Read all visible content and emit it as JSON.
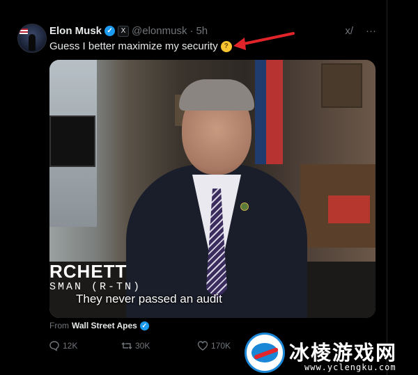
{
  "post": {
    "author_name": "Elon Musk",
    "author_handle": "@elonmusk",
    "separator": "·",
    "time": "5h",
    "x_badge": "X",
    "text": "Guess I better maximize my security",
    "emoji_name": "thinking-face"
  },
  "top_icons": {
    "grok": "x/",
    "more": "···"
  },
  "video": {
    "lower_third_name": "RCHETT",
    "lower_third_title": "SMAN (R-TN)",
    "caption": "They never passed an audit"
  },
  "attribution": {
    "prefix": "From",
    "source": "Wall Street Apes"
  },
  "actions": {
    "replies": "12K",
    "reposts": "30K",
    "likes": "170K"
  },
  "watermark": {
    "site_name": "冰棱游戏网",
    "url": "www.yclengku.com"
  },
  "colors": {
    "accent": "#1d9bf0",
    "arrow": "#e0242a",
    "muted": "#71767b"
  }
}
